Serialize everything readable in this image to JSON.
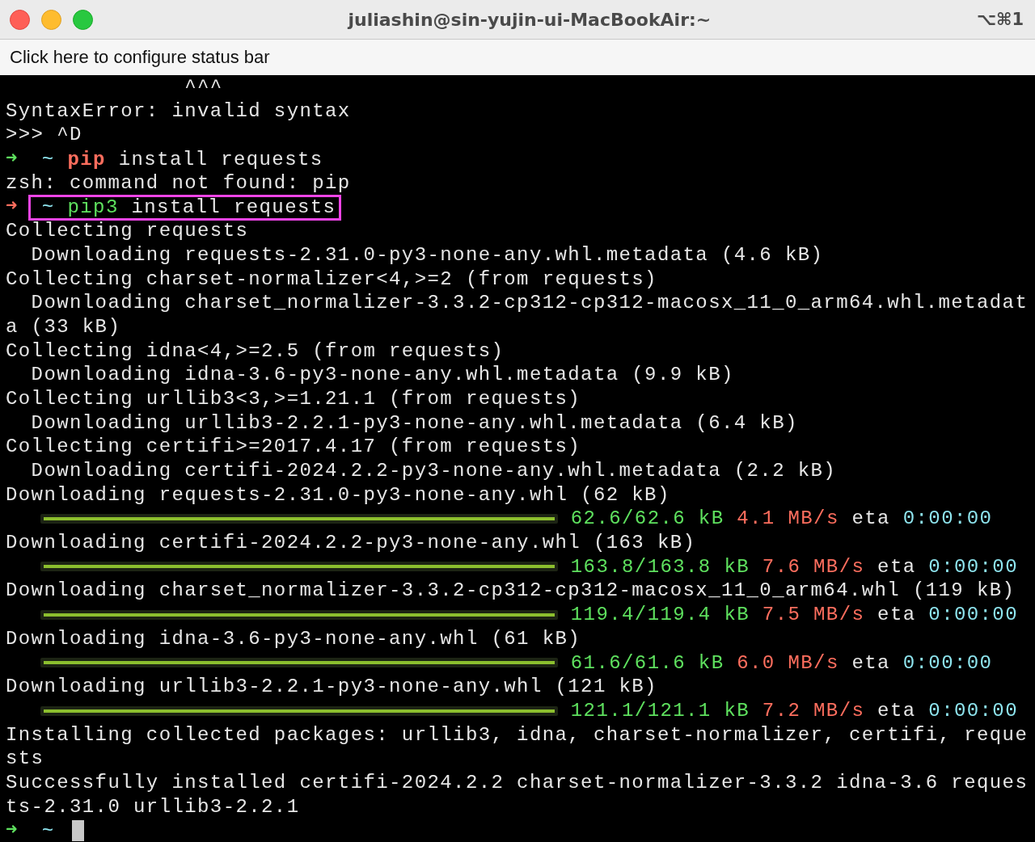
{
  "window": {
    "title": "juliashin@sin-yujin-ui-MacBookAir:~",
    "shortcut": "⌥⌘1"
  },
  "status_bar": {
    "text": "Click here to configure status bar"
  },
  "lines": [
    {
      "kind": "text",
      "text": "              ^^^"
    },
    {
      "kind": "text",
      "text": "SyntaxError: invalid syntax"
    },
    {
      "kind": "text",
      "text": ">>> ^D"
    },
    {
      "kind": "prompt",
      "last_succeeded": true,
      "arrow": "➜",
      "dir": "~",
      "command": "pip",
      "command_found": false,
      "args": "install requests",
      "highlighted": false
    },
    {
      "kind": "text",
      "text": "zsh: command not found: pip"
    },
    {
      "kind": "prompt",
      "last_succeeded": false,
      "arrow": "➜",
      "dir": "~",
      "command": "pip3",
      "command_found": true,
      "args": "install requests",
      "highlighted": true
    },
    {
      "kind": "text",
      "text": "Collecting requests"
    },
    {
      "kind": "text",
      "text": "  Downloading requests-2.31.0-py3-none-any.whl.metadata (4.6 kB)"
    },
    {
      "kind": "text",
      "text": "Collecting charset-normalizer<4,>=2 (from requests)"
    },
    {
      "kind": "text",
      "text": "  Downloading charset_normalizer-3.3.2-cp312-cp312-macosx_11_0_arm64.whl.metadat"
    },
    {
      "kind": "text",
      "text": "a (33 kB)"
    },
    {
      "kind": "text",
      "text": "Collecting idna<4,>=2.5 (from requests)"
    },
    {
      "kind": "text",
      "text": "  Downloading idna-3.6-py3-none-any.whl.metadata (9.9 kB)"
    },
    {
      "kind": "text",
      "text": "Collecting urllib3<3,>=1.21.1 (from requests)"
    },
    {
      "kind": "text",
      "text": "  Downloading urllib3-2.2.1-py3-none-any.whl.metadata (6.4 kB)"
    },
    {
      "kind": "text",
      "text": "Collecting certifi>=2017.4.17 (from requests)"
    },
    {
      "kind": "text",
      "text": "  Downloading certifi-2024.2.2-py3-none-any.whl.metadata (2.2 kB)"
    },
    {
      "kind": "text",
      "text": "Downloading requests-2.31.0-py3-none-any.whl (62 kB)"
    },
    {
      "kind": "progress",
      "level": 1,
      "size": "62.6/62.6 kB",
      "rate": "4.1 MB/s",
      "eta_label": "eta",
      "eta": "0:00:00"
    },
    {
      "kind": "text",
      "text": "Downloading certifi-2024.2.2-py3-none-any.whl (163 kB)"
    },
    {
      "kind": "progress",
      "level": 1,
      "size": "163.8/163.8 kB",
      "rate": "7.6 MB/s",
      "eta_label": "eta",
      "eta": "0:00:00"
    },
    {
      "kind": "text",
      "text": "Downloading charset_normalizer-3.3.2-cp312-cp312-macosx_11_0_arm64.whl (119 kB)"
    },
    {
      "kind": "progress",
      "level": 1,
      "size": "119.4/119.4 kB",
      "rate": "7.5 MB/s",
      "eta_label": "eta",
      "eta": "0:00:00"
    },
    {
      "kind": "text",
      "text": "Downloading idna-3.6-py3-none-any.whl (61 kB)"
    },
    {
      "kind": "progress",
      "level": 1,
      "size": "61.6/61.6 kB",
      "rate": "6.0 MB/s",
      "eta_label": "eta",
      "eta": "0:00:00"
    },
    {
      "kind": "text",
      "text": "Downloading urllib3-2.2.1-py3-none-any.whl (121 kB)"
    },
    {
      "kind": "progress",
      "level": 1,
      "size": "121.1/121.1 kB",
      "rate": "7.2 MB/s",
      "eta_label": "eta",
      "eta": "0:00:00"
    },
    {
      "kind": "text",
      "text": "Installing collected packages: urllib3, idna, charset-normalizer, certifi, reque"
    },
    {
      "kind": "text",
      "text": "sts"
    },
    {
      "kind": "text",
      "text": "Successfully installed certifi-2024.2.2 charset-normalizer-3.3.2 idna-3.6 reques"
    },
    {
      "kind": "text",
      "text": "ts-2.31.0 urllib3-2.2.1"
    },
    {
      "kind": "prompt",
      "last_succeeded": true,
      "arrow": "➜",
      "dir": "~",
      "highlighted": false
    }
  ]
}
